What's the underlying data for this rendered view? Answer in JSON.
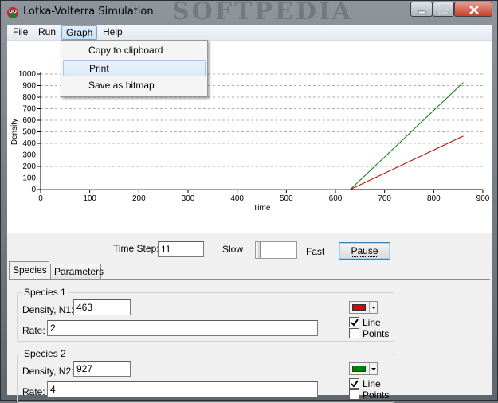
{
  "window": {
    "title": "Lotka-Volterra Simulation",
    "watermark": "SOFTPEDIA"
  },
  "menu": {
    "items": [
      "File",
      "Run",
      "Graph",
      "Help"
    ],
    "active": "Graph"
  },
  "graph_menu": {
    "items": [
      "Copy to clipboard",
      "Print",
      "Save as bitmap"
    ],
    "highlighted": "Print"
  },
  "chart_data": {
    "type": "line",
    "xlabel": "Time",
    "ylabel": "Density",
    "xlim": [
      0,
      900
    ],
    "ylim": [
      0,
      1000
    ],
    "xticks": [
      0,
      100,
      200,
      300,
      400,
      500,
      600,
      700,
      800,
      900
    ],
    "yticks": [
      0,
      100,
      200,
      300,
      400,
      500,
      600,
      700,
      800,
      900,
      1000
    ],
    "grid": "horizontal dashed",
    "series": [
      {
        "color": "#c00000",
        "x": [
          0,
          630,
          860
        ],
        "y": [
          0,
          0,
          463
        ]
      },
      {
        "color": "#008000",
        "x": [
          0,
          630,
          860
        ],
        "y": [
          0,
          0,
          927
        ]
      }
    ]
  },
  "controls": {
    "time_step_label": "Time Step:",
    "time_step_value": "11",
    "slow_label": "Slow",
    "fast_label": "Fast",
    "speed_level": 0,
    "pause_label": "Pause"
  },
  "tabs": [
    "Species",
    "Parameters"
  ],
  "active_tab": "Species",
  "species": [
    {
      "title": "Species 1",
      "density_label": "Density, N1:",
      "density_value": "463",
      "rate_label": "Rate:",
      "rate_value": "2",
      "color": "#e00000",
      "line_label": "Line",
      "line_checked": true,
      "points_label": "Points",
      "points_checked": false
    },
    {
      "title": "Species 2",
      "density_label": "Density, N2:",
      "density_value": "927",
      "rate_label": "Rate:",
      "rate_value": "4",
      "color": "#008000",
      "line_label": "Line",
      "line_checked": true,
      "points_label": "Points",
      "points_checked": false
    }
  ]
}
